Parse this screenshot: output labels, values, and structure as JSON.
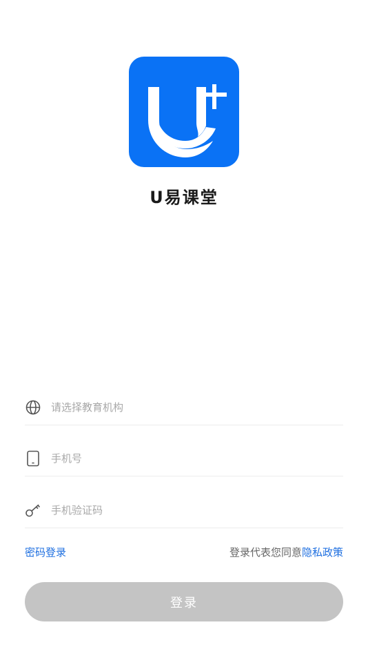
{
  "app": {
    "name": "U易课堂",
    "brand_color": "#0A72F5"
  },
  "form": {
    "org": {
      "placeholder": "请选择教育机构",
      "icon": "globe-icon"
    },
    "phone": {
      "placeholder": "手机号",
      "icon": "phone-icon"
    },
    "code": {
      "placeholder": "手机验证码",
      "icon": "key-icon"
    }
  },
  "links": {
    "password_login": "密码登录",
    "agree_text": "登录代表您同意",
    "privacy_policy": "隐私政策",
    "link_color": "#1E6FE0"
  },
  "login_button": {
    "label": "登录",
    "state": "disabled",
    "color": "#c4c4c4"
  }
}
